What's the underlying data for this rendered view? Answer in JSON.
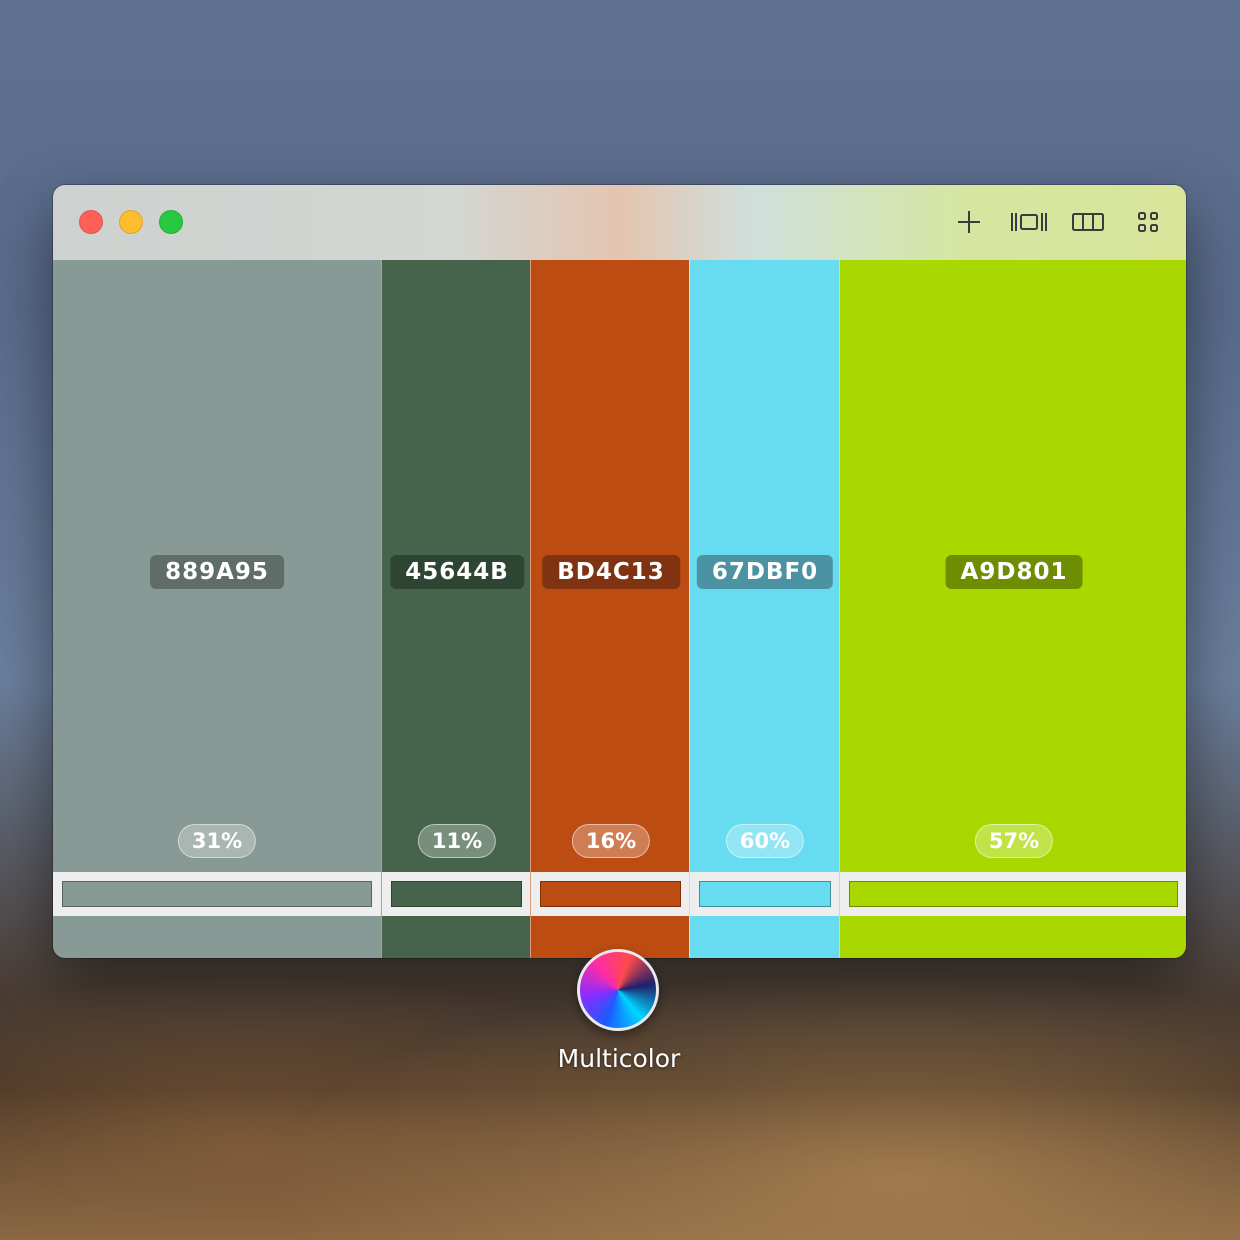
{
  "window": {
    "traffic_lights": {
      "close": "#fe5f57",
      "minimize": "#febc2e",
      "zoom": "#28c840"
    },
    "toolbar": {
      "icons": [
        "plus-icon",
        "carousel-view-icon",
        "columns-view-icon",
        "grid-view-icon"
      ]
    }
  },
  "swatches": [
    {
      "hex_label": "889A95",
      "color": "#889A95",
      "percent": "31%",
      "label_bg": "#5f6c68"
    },
    {
      "hex_label": "45644B",
      "color": "#45644B",
      "percent": "11%",
      "label_bg": "#2f4533"
    },
    {
      "hex_label": "BD4C13",
      "color": "#BD4C13",
      "percent": "16%",
      "label_bg": "#7f3310"
    },
    {
      "hex_label": "67DBF0",
      "color": "#67DBF0",
      "percent": "60%",
      "label_bg": "#4b93a2"
    },
    {
      "hex_label": "A9D801",
      "color": "#A9D801",
      "percent": "57%",
      "label_bg": "#6f8d00"
    }
  ],
  "dock_item": {
    "label": "Multicolor",
    "icon": "multicolor-icon"
  }
}
